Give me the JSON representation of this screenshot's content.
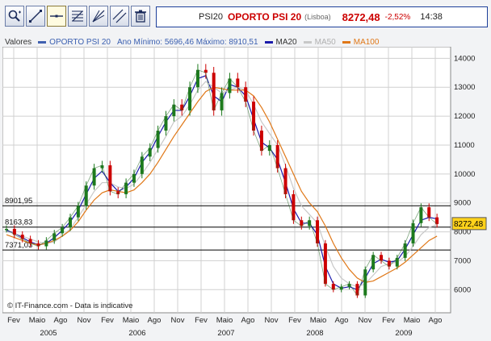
{
  "toolbar": {
    "tools": [
      {
        "name": "zoom-tool-icon",
        "active": false
      },
      {
        "name": "trend-line-tool-icon",
        "active": false
      },
      {
        "name": "horizontal-line-tool-icon",
        "active": true
      },
      {
        "name": "fibonacci-tool-icon",
        "active": false
      },
      {
        "name": "fan-line-tool-icon",
        "active": false
      },
      {
        "name": "channel-tool-icon",
        "active": false
      },
      {
        "name": "trash-icon",
        "active": false
      }
    ]
  },
  "ticker": {
    "code": "PSI20",
    "name": "OPORTO PSI 20",
    "market": "(Lisboa)",
    "price": "8272,48",
    "change": "-2,52%",
    "time": "14:38"
  },
  "legend": {
    "title": "Valores",
    "series_label": "OPORTO PSI 20",
    "range_text": "Ano Mínimo: 5696,46 Máximo: 8910,51",
    "ma20": "MA20",
    "ma50": "MA50",
    "ma100": "MA100"
  },
  "colors": {
    "up_candle": "#1d7a1d",
    "down_candle": "#cc0000",
    "ma20": "#1a1aaa",
    "ma50": "#c8c8c8",
    "ma100": "#e07818",
    "series_swatch": "#4060b0",
    "accent": "#1d3f9a"
  },
  "footer": {
    "credit": "© IT-Finance.com - Data is indicative"
  },
  "current_price_tag": "8272,48",
  "reference_lines": [
    {
      "label": "8901,95",
      "value": 8901.95
    },
    {
      "label": "8163,83",
      "value": 8163.83
    },
    {
      "label": "7371,03",
      "value": 7371.03
    }
  ],
  "chart_data": {
    "type": "line",
    "title": "OPORTO PSI 20",
    "ylim": [
      5200,
      14400
    ],
    "y_ticks": [
      "6000",
      "7000",
      "8000",
      "9000",
      "10000",
      "11000",
      "12000",
      "13000",
      "14000"
    ],
    "x_ticks": [
      "Fev",
      "Maio",
      "Ago",
      "Nov",
      "Fev",
      "Maio",
      "Ago",
      "Nov",
      "Fev",
      "Maio",
      "Ago",
      "Nov",
      "Fev",
      "Maio",
      "Ago",
      "Nov",
      "Fev",
      "Maio",
      "Ago"
    ],
    "x_years": [
      "2005",
      "2006",
      "2007",
      "2008",
      "2009"
    ],
    "x_start": 0,
    "x_end": 55,
    "series": [
      {
        "name": "OPORTO PSI 20",
        "x": [
          0,
          1,
          2,
          3,
          4,
          5,
          6,
          7,
          8,
          9,
          10,
          11,
          12,
          13,
          14,
          15,
          16,
          17,
          18,
          19,
          20,
          21,
          22,
          23,
          24,
          25,
          26,
          27,
          28,
          29,
          30,
          31,
          32,
          33,
          34,
          35,
          36,
          37,
          38,
          39,
          40,
          41,
          42,
          43,
          44,
          45,
          46,
          47,
          48,
          49,
          50,
          51,
          52,
          53,
          54
        ],
        "values": [
          8100,
          7900,
          7750,
          7600,
          7500,
          7700,
          7950,
          8150,
          8500,
          8900,
          9600,
          10200,
          10300,
          9400,
          9300,
          9700,
          10000,
          10600,
          10900,
          11500,
          12000,
          12400,
          12200,
          13000,
          13600,
          13500,
          12200,
          12800,
          13300,
          13000,
          12500,
          11500,
          10800,
          11000,
          10200,
          9300,
          8400,
          8200,
          8400,
          7600,
          6200,
          6000,
          6100,
          6200,
          5800,
          6700,
          7200,
          7000,
          6800,
          7100,
          7600,
          8300,
          8850,
          8500,
          8270
        ]
      },
      {
        "name": "MA20",
        "x": [
          0,
          1,
          2,
          3,
          4,
          5,
          6,
          7,
          8,
          9,
          10,
          11,
          12,
          13,
          14,
          15,
          16,
          17,
          18,
          19,
          20,
          21,
          22,
          23,
          24,
          25,
          26,
          27,
          28,
          29,
          30,
          31,
          32,
          33,
          34,
          35,
          36,
          37,
          38,
          39,
          40,
          41,
          42,
          43,
          44,
          45,
          46,
          47,
          48,
          49,
          50,
          51,
          52,
          53,
          54
        ],
        "values": [
          8050,
          7950,
          7800,
          7650,
          7550,
          7600,
          7800,
          8050,
          8350,
          8750,
          9300,
          9850,
          10100,
          9700,
          9400,
          9550,
          9850,
          10400,
          10750,
          11300,
          11800,
          12200,
          12200,
          12700,
          13300,
          13400,
          12700,
          12500,
          13100,
          13000,
          12700,
          11900,
          11100,
          10900,
          10500,
          9700,
          8800,
          8300,
          8300,
          7900,
          6800,
          6200,
          6050,
          6100,
          6000,
          6400,
          6900,
          7050,
          6950,
          7000,
          7400,
          7900,
          8400,
          8500,
          8450
        ]
      },
      {
        "name": "MA50",
        "x": [
          0,
          1,
          2,
          3,
          4,
          5,
          6,
          7,
          8,
          9,
          10,
          11,
          12,
          13,
          14,
          15,
          16,
          17,
          18,
          19,
          20,
          21,
          22,
          23,
          24,
          25,
          26,
          27,
          28,
          29,
          30,
          31,
          32,
          33,
          34,
          35,
          36,
          37,
          38,
          39,
          40,
          41,
          42,
          43,
          44,
          45,
          46,
          47,
          48,
          49,
          50,
          51,
          52,
          53,
          54
        ],
        "values": [
          8000,
          7950,
          7850,
          7750,
          7650,
          7600,
          7650,
          7850,
          8100,
          8500,
          8950,
          9400,
          9700,
          9700,
          9550,
          9500,
          9650,
          10000,
          10400,
          10850,
          11300,
          11800,
          12000,
          12400,
          12900,
          13200,
          13000,
          12800,
          12900,
          13000,
          12900,
          12400,
          11800,
          11400,
          11000,
          10300,
          9500,
          8900,
          8600,
          8300,
          7500,
          6800,
          6400,
          6200,
          6100,
          6200,
          6500,
          6800,
          6900,
          6950,
          7150,
          7500,
          7900,
          8150,
          8250
        ]
      },
      {
        "name": "MA100",
        "x": [
          0,
          1,
          2,
          3,
          4,
          5,
          6,
          7,
          8,
          9,
          10,
          11,
          12,
          13,
          14,
          15,
          16,
          17,
          18,
          19,
          20,
          21,
          22,
          23,
          24,
          25,
          26,
          27,
          28,
          29,
          30,
          31,
          32,
          33,
          34,
          35,
          36,
          37,
          38,
          39,
          40,
          41,
          42,
          43,
          44,
          45,
          46,
          47,
          48,
          49,
          50,
          51,
          52,
          53,
          54
        ],
        "values": [
          7900,
          7800,
          7700,
          7600,
          7550,
          7600,
          7700,
          7850,
          8050,
          8350,
          8750,
          9100,
          9350,
          9450,
          9400,
          9350,
          9450,
          9700,
          10000,
          10400,
          10850,
          11300,
          11700,
          12100,
          12500,
          12850,
          13000,
          12950,
          12900,
          12900,
          12900,
          12700,
          12300,
          11800,
          11200,
          10600,
          10000,
          9400,
          9000,
          8700,
          8200,
          7600,
          7100,
          6700,
          6400,
          6250,
          6300,
          6450,
          6600,
          6750,
          6950,
          7200,
          7450,
          7700,
          7850
        ]
      }
    ],
    "grid": true,
    "legend": "top-left"
  }
}
